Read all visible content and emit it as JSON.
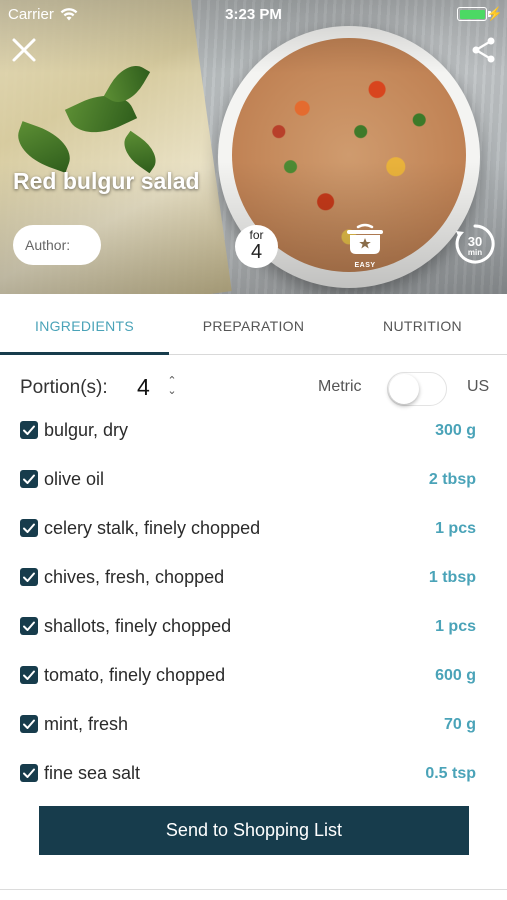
{
  "status_bar": {
    "carrier": "Carrier",
    "time": "3:23 PM",
    "battery_color": "#4cd964",
    "icons": [
      "wifi-icon",
      "battery-icon",
      "charging-bolt-icon"
    ]
  },
  "hero": {
    "title": "Red bulgur salad",
    "author_label": "Author:",
    "servings_for": "for",
    "servings_count": "4",
    "difficulty_label": "EASY",
    "time_value": "30",
    "time_unit": "min"
  },
  "tabs": [
    {
      "label": "INGREDIENTS",
      "active": true
    },
    {
      "label": "PREPARATION",
      "active": false
    },
    {
      "label": "NUTRITION",
      "active": false
    }
  ],
  "portions": {
    "label": "Portion(s):",
    "value": "4",
    "unit_left": "Metric",
    "unit_right": "US",
    "toggle_on": false
  },
  "ingredients": [
    {
      "name": "bulgur, dry",
      "qty": "300 g",
      "checked": true
    },
    {
      "name": "olive oil",
      "qty": "2 tbsp",
      "checked": true
    },
    {
      "name": "celery stalk, finely chopped",
      "qty": "1 pcs",
      "checked": true
    },
    {
      "name": "chives, fresh, chopped",
      "qty": "1 tbsp",
      "checked": true
    },
    {
      "name": "shallots, finely chopped",
      "qty": "1 pcs",
      "checked": true
    },
    {
      "name": "tomato, finely chopped",
      "qty": "600 g",
      "checked": true
    },
    {
      "name": "mint, fresh",
      "qty": "70 g",
      "checked": true
    },
    {
      "name": "fine sea salt",
      "qty": "0.5 tsp",
      "checked": true
    }
  ],
  "actions": {
    "send_label": "Send to Shopping List"
  },
  "colors": {
    "accent": "#4aa3b8",
    "primary_dark": "#173c4c"
  }
}
